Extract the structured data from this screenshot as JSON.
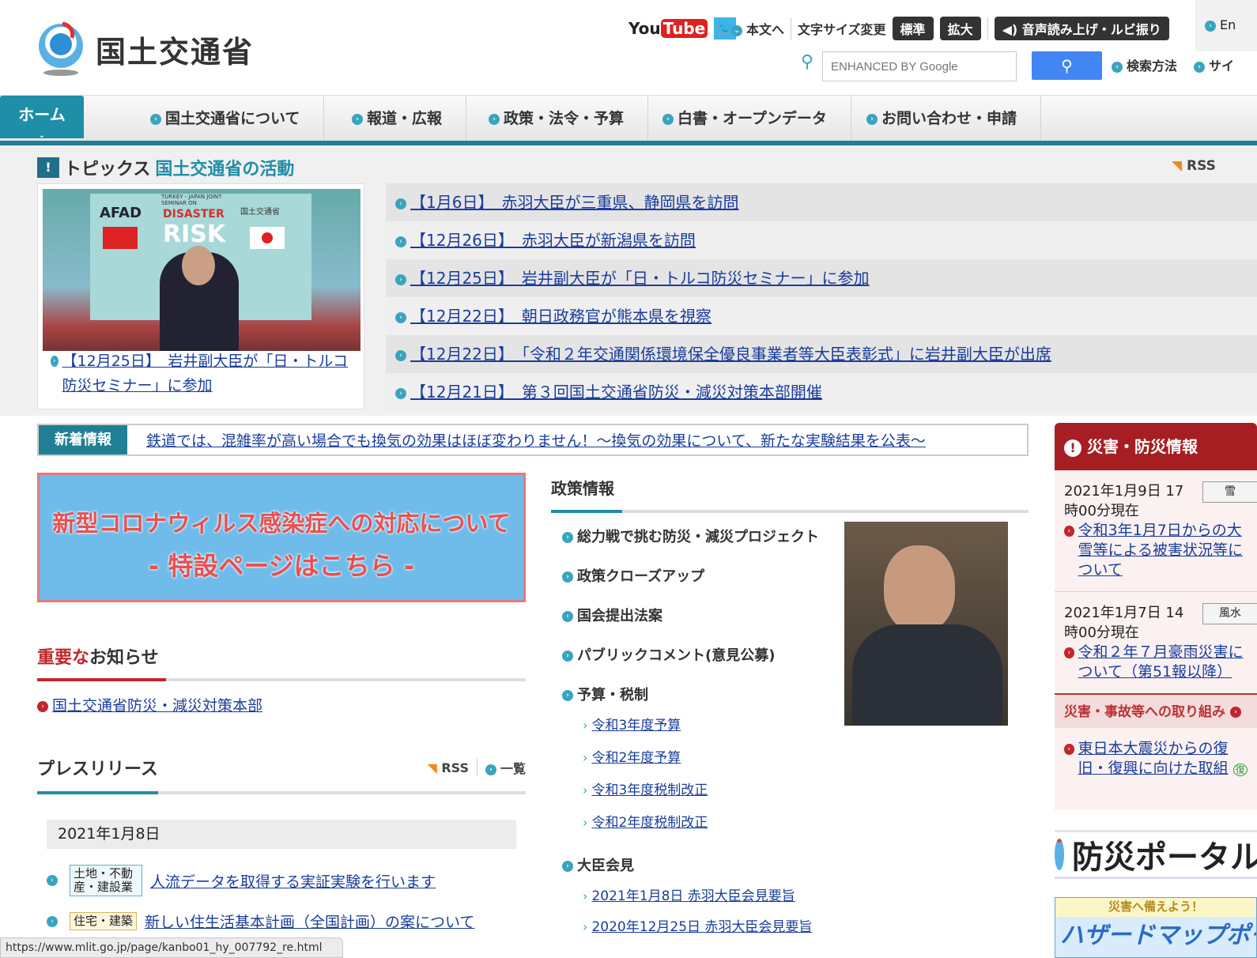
{
  "header": {
    "logo_text": "国土交通省",
    "youtube": "YouTube",
    "twitter": "Twitter",
    "skip": "本文へ",
    "font_size_label": "文字サイズ変更",
    "font_std": "標準",
    "font_large": "拡大",
    "speech": "音声読み上げ・ルビ振り",
    "english": "En",
    "search_placeholder": "ENHANCED BY Google",
    "search_method": "検索方法",
    "sitemap": "サイ"
  },
  "nav": {
    "items": [
      "ホーム",
      "国土交通省について",
      "報道・広報",
      "政策・法令・予算",
      "白書・オープンデータ",
      "お問い合わせ・申請"
    ]
  },
  "topics": {
    "title": "トピックス",
    "subtitle": "国土交通省の活動",
    "rss": "RSS",
    "feature_caption": "【12月25日】　岩井副大臣が「日・トルコ防災セミナー」に参加",
    "image_text": [
      "AFAD",
      "TURKEY - JAPAN JOINT SEMINAR ON",
      "DISASTER",
      "RISK",
      "国土交通省"
    ],
    "items": [
      "【1月6日】　赤羽大臣が三重県、静岡県を訪問",
      "【12月26日】　赤羽大臣が新潟県を訪問",
      "【12月25日】　岩井副大臣が「日・トルコ防災セミナー」に参加",
      "【12月22日】　朝日政務官が熊本県を視察",
      "【12月22日】　「令和２年交通関係環境保全優良事業者等大臣表彰式」に岩井副大臣が出席",
      "【12月21日】　第３回国土交通省防災・減災対策本部開催"
    ]
  },
  "news": {
    "label": "新着情報",
    "text": "鉄道では、混雑率が高い場合でも換気の効果はほぼ変わりません！～換気の効果について、新たな実験結果を公表～"
  },
  "covid": {
    "line1": "新型コロナウィルス感染症への対応について",
    "line2": "- 特設ページはこちら -"
  },
  "important": {
    "title_red": "重要な",
    "title_rest": "お知らせ",
    "items": [
      "国土交通省防災・減災対策本部"
    ]
  },
  "press": {
    "title": "プレスリリース",
    "rss": "RSS",
    "list": "一覧",
    "date": "2021年1月8日",
    "items": [
      {
        "category": "土地・不動産・建設業",
        "title": "人流データを取得する実証実験を行います"
      },
      {
        "category": "住宅・建築",
        "title": "新しい住生活基本計画（全国計画）の案について"
      }
    ]
  },
  "policy": {
    "title": "政策情報",
    "items": [
      "総力戦で挑む防災・減災プロジェクト",
      "政策クローズアップ",
      "国会提出法案",
      "パブリックコメント(意見公募)",
      "予算・税制"
    ],
    "budget": [
      "令和3年度予算",
      "令和2年度予算",
      "令和3年度税制改正",
      "令和2年度税制改正"
    ],
    "press_conf_title": "大臣会見",
    "press_conf": [
      "2021年1月8日 赤羽大臣会見要旨",
      "2020年12月25日 赤羽大臣会見要旨"
    ]
  },
  "disaster": {
    "title": "災害・防災情報",
    "entries": [
      {
        "time": "2021年1月9日 17時00分現在",
        "tag": "雪",
        "link": "令和3年1月7日からの大雪等による被害状況等について"
      },
      {
        "time": "2021年1月7日 14時00分現在",
        "tag": "風水",
        "link": "令和２年７月豪雨災害について（第51報以降）"
      }
    ],
    "efforts_title": "災害・事故等への取り組み",
    "efforts": [
      "東日本大震災からの復旧・復興に向けた取組"
    ],
    "efforts_badge": "復",
    "portal": "防災ポータル",
    "hazard_top": "災害へ備えよう！",
    "hazard": "ハザードマップポータル"
  },
  "status_url": "https://www.mlit.go.jp/page/kanbo01_hy_007792_re.html",
  "colors": {
    "accent": "#1f8ea7",
    "disaster": "#a61e22",
    "link": "#1a3d9c"
  }
}
